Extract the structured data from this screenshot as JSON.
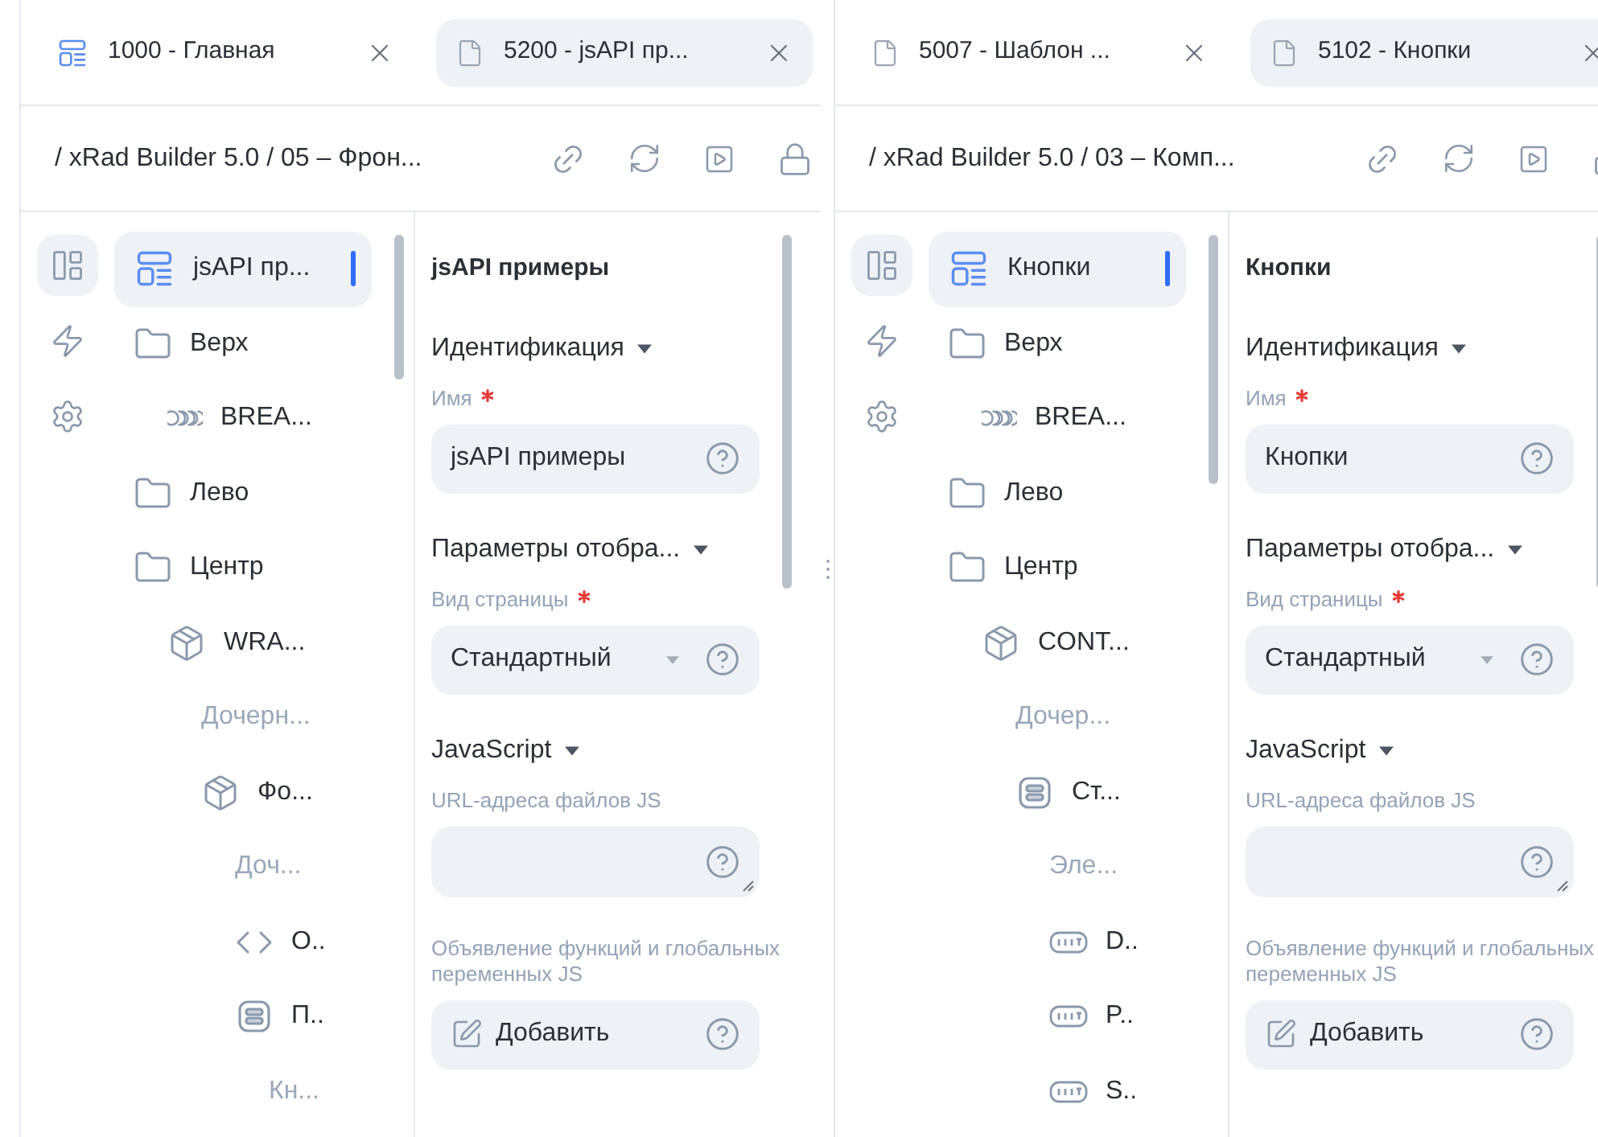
{
  "panes": [
    {
      "tabs": [
        {
          "label": "1000 - Главная",
          "kind": "home",
          "selected": false
        },
        {
          "label": "5200 - jsAPI пр...",
          "kind": "page",
          "selected": true
        }
      ],
      "breadcrumb": "/ xRad Builder 5.0 / 05 – Фрон...",
      "rail": [
        {
          "kind": "structure",
          "selected": true
        },
        {
          "kind": "events",
          "selected": false
        },
        {
          "kind": "settings",
          "selected": false
        }
      ],
      "tree": [
        {
          "label": "jsAPI пр...",
          "kind": "page",
          "selected": true
        },
        {
          "label": "Верх",
          "kind": "folder",
          "selected": false,
          "children": [
            {
              "label": "BREA...",
              "kind": "breadcrumbs",
              "selected": false
            }
          ]
        },
        {
          "label": "Лево",
          "kind": "folder",
          "selected": false
        },
        {
          "label": "Центр",
          "kind": "folder",
          "selected": false,
          "children": [
            {
              "label": "WRA...",
              "kind": "box",
              "selected": false,
              "children": [
                {
                  "label": "Дочерн...",
                  "kind": "label",
                  "selected": false
                },
                {
                  "label": "Фо...",
                  "kind": "box",
                  "selected": false,
                  "children": [
                    {
                      "label": "Доч...",
                      "kind": "label",
                      "selected": false
                    },
                    {
                      "label": "О..",
                      "kind": "code",
                      "selected": false
                    },
                    {
                      "label": "П..",
                      "kind": "container",
                      "selected": false,
                      "children": [
                        {
                          "label": "Кн...",
                          "kind": "label",
                          "selected": false
                        }
                      ]
                    }
                  ]
                }
              ]
            }
          ]
        }
      ],
      "props": {
        "title": "jsAPI примеры",
        "sections": [
          {
            "heading": "Идентификация",
            "fields": [
              {
                "label": "Имя",
                "required": true,
                "kind": "text",
                "value": "jsAPI примеры"
              }
            ]
          },
          {
            "heading": "Параметры отобра...",
            "fields": [
              {
                "label": "Вид страницы",
                "required": true,
                "kind": "select",
                "value": "Стандартный"
              }
            ]
          },
          {
            "heading": "JavaScript",
            "fields": [
              {
                "label": "URL-адреса файлов JS",
                "required": false,
                "kind": "textarea"
              },
              {
                "label": "Объявление функций и глобальных переменных JS",
                "required": false,
                "kind": "button",
                "value": "Добавить"
              }
            ]
          }
        ]
      }
    },
    {
      "tabs": [
        {
          "label": "5007 - Шаблон ...",
          "kind": "page",
          "selected": false
        },
        {
          "label": "5102 - Кнопки",
          "kind": "page",
          "selected": true
        }
      ],
      "breadcrumb": "/ xRad Builder 5.0 / 03 – Комп...",
      "rail": [
        {
          "kind": "structure",
          "selected": true
        },
        {
          "kind": "events",
          "selected": false
        },
        {
          "kind": "settings",
          "selected": false
        }
      ],
      "tree": [
        {
          "label": "Кнопки",
          "kind": "page",
          "selected": true
        },
        {
          "label": "Верх",
          "kind": "folder",
          "selected": false,
          "children": [
            {
              "label": "BREA...",
              "kind": "breadcrumbs",
              "selected": false
            }
          ]
        },
        {
          "label": "Лево",
          "kind": "folder",
          "selected": false
        },
        {
          "label": "Центр",
          "kind": "folder",
          "selected": false,
          "children": [
            {
              "label": "CONT...",
              "kind": "box",
              "selected": false,
              "children": [
                {
                  "label": "Дочер...",
                  "kind": "label",
                  "selected": false
                },
                {
                  "label": "Ст...",
                  "kind": "container",
                  "selected": false,
                  "children": [
                    {
                      "label": "Эле...",
                      "kind": "label",
                      "selected": false
                    },
                    {
                      "label": "D..",
                      "kind": "button",
                      "selected": false
                    },
                    {
                      "label": "P..",
                      "kind": "button",
                      "selected": false
                    },
                    {
                      "label": "S..",
                      "kind": "button",
                      "selected": false
                    }
                  ]
                }
              ]
            }
          ]
        }
      ],
      "props": {
        "title": "Кнопки",
        "sections": [
          {
            "heading": "Идентификация",
            "fields": [
              {
                "label": "Имя",
                "required": true,
                "kind": "text",
                "value": "Кнопки"
              }
            ]
          },
          {
            "heading": "Параметры отобра...",
            "fields": [
              {
                "label": "Вид страницы",
                "required": true,
                "kind": "select",
                "value": "Стандартный"
              }
            ]
          },
          {
            "heading": "JavaScript",
            "fields": [
              {
                "label": "URL-адреса файлов JS",
                "required": false,
                "kind": "textarea"
              },
              {
                "label": "Объявление функций и глобальных переменных JS",
                "required": false,
                "kind": "button",
                "value": "Добавить"
              }
            ]
          }
        ]
      }
    }
  ]
}
